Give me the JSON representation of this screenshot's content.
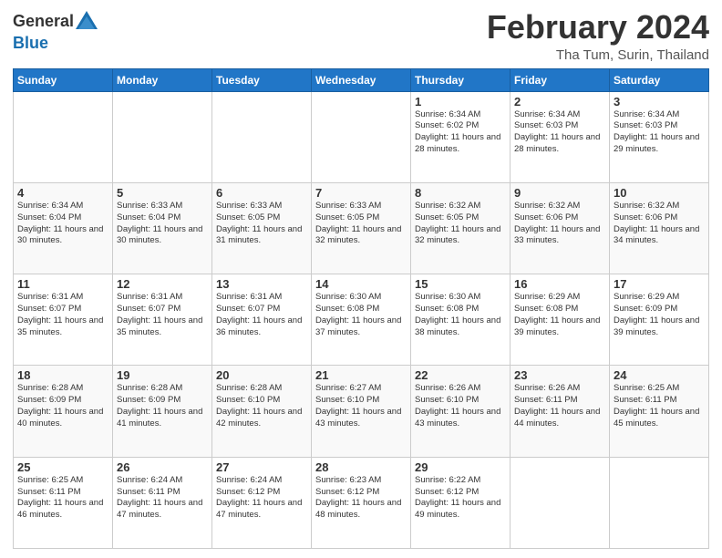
{
  "logo": {
    "text_general": "General",
    "text_blue": "Blue"
  },
  "title": {
    "month_year": "February 2024",
    "location": "Tha Tum, Surin, Thailand"
  },
  "weekdays": [
    "Sunday",
    "Monday",
    "Tuesday",
    "Wednesday",
    "Thursday",
    "Friday",
    "Saturday"
  ],
  "weeks": [
    [
      {
        "day": "",
        "info": ""
      },
      {
        "day": "",
        "info": ""
      },
      {
        "day": "",
        "info": ""
      },
      {
        "day": "",
        "info": ""
      },
      {
        "day": "1",
        "info": "Sunrise: 6:34 AM\nSunset: 6:02 PM\nDaylight: 11 hours and 28 minutes."
      },
      {
        "day": "2",
        "info": "Sunrise: 6:34 AM\nSunset: 6:03 PM\nDaylight: 11 hours and 28 minutes."
      },
      {
        "day": "3",
        "info": "Sunrise: 6:34 AM\nSunset: 6:03 PM\nDaylight: 11 hours and 29 minutes."
      }
    ],
    [
      {
        "day": "4",
        "info": "Sunrise: 6:34 AM\nSunset: 6:04 PM\nDaylight: 11 hours and 30 minutes."
      },
      {
        "day": "5",
        "info": "Sunrise: 6:33 AM\nSunset: 6:04 PM\nDaylight: 11 hours and 30 minutes."
      },
      {
        "day": "6",
        "info": "Sunrise: 6:33 AM\nSunset: 6:05 PM\nDaylight: 11 hours and 31 minutes."
      },
      {
        "day": "7",
        "info": "Sunrise: 6:33 AM\nSunset: 6:05 PM\nDaylight: 11 hours and 32 minutes."
      },
      {
        "day": "8",
        "info": "Sunrise: 6:32 AM\nSunset: 6:05 PM\nDaylight: 11 hours and 32 minutes."
      },
      {
        "day": "9",
        "info": "Sunrise: 6:32 AM\nSunset: 6:06 PM\nDaylight: 11 hours and 33 minutes."
      },
      {
        "day": "10",
        "info": "Sunrise: 6:32 AM\nSunset: 6:06 PM\nDaylight: 11 hours and 34 minutes."
      }
    ],
    [
      {
        "day": "11",
        "info": "Sunrise: 6:31 AM\nSunset: 6:07 PM\nDaylight: 11 hours and 35 minutes."
      },
      {
        "day": "12",
        "info": "Sunrise: 6:31 AM\nSunset: 6:07 PM\nDaylight: 11 hours and 35 minutes."
      },
      {
        "day": "13",
        "info": "Sunrise: 6:31 AM\nSunset: 6:07 PM\nDaylight: 11 hours and 36 minutes."
      },
      {
        "day": "14",
        "info": "Sunrise: 6:30 AM\nSunset: 6:08 PM\nDaylight: 11 hours and 37 minutes."
      },
      {
        "day": "15",
        "info": "Sunrise: 6:30 AM\nSunset: 6:08 PM\nDaylight: 11 hours and 38 minutes."
      },
      {
        "day": "16",
        "info": "Sunrise: 6:29 AM\nSunset: 6:08 PM\nDaylight: 11 hours and 39 minutes."
      },
      {
        "day": "17",
        "info": "Sunrise: 6:29 AM\nSunset: 6:09 PM\nDaylight: 11 hours and 39 minutes."
      }
    ],
    [
      {
        "day": "18",
        "info": "Sunrise: 6:28 AM\nSunset: 6:09 PM\nDaylight: 11 hours and 40 minutes."
      },
      {
        "day": "19",
        "info": "Sunrise: 6:28 AM\nSunset: 6:09 PM\nDaylight: 11 hours and 41 minutes."
      },
      {
        "day": "20",
        "info": "Sunrise: 6:28 AM\nSunset: 6:10 PM\nDaylight: 11 hours and 42 minutes."
      },
      {
        "day": "21",
        "info": "Sunrise: 6:27 AM\nSunset: 6:10 PM\nDaylight: 11 hours and 43 minutes."
      },
      {
        "day": "22",
        "info": "Sunrise: 6:26 AM\nSunset: 6:10 PM\nDaylight: 11 hours and 43 minutes."
      },
      {
        "day": "23",
        "info": "Sunrise: 6:26 AM\nSunset: 6:11 PM\nDaylight: 11 hours and 44 minutes."
      },
      {
        "day": "24",
        "info": "Sunrise: 6:25 AM\nSunset: 6:11 PM\nDaylight: 11 hours and 45 minutes."
      }
    ],
    [
      {
        "day": "25",
        "info": "Sunrise: 6:25 AM\nSunset: 6:11 PM\nDaylight: 11 hours and 46 minutes."
      },
      {
        "day": "26",
        "info": "Sunrise: 6:24 AM\nSunset: 6:11 PM\nDaylight: 11 hours and 47 minutes."
      },
      {
        "day": "27",
        "info": "Sunrise: 6:24 AM\nSunset: 6:12 PM\nDaylight: 11 hours and 47 minutes."
      },
      {
        "day": "28",
        "info": "Sunrise: 6:23 AM\nSunset: 6:12 PM\nDaylight: 11 hours and 48 minutes."
      },
      {
        "day": "29",
        "info": "Sunrise: 6:22 AM\nSunset: 6:12 PM\nDaylight: 11 hours and 49 minutes."
      },
      {
        "day": "",
        "info": ""
      },
      {
        "day": "",
        "info": ""
      }
    ]
  ]
}
